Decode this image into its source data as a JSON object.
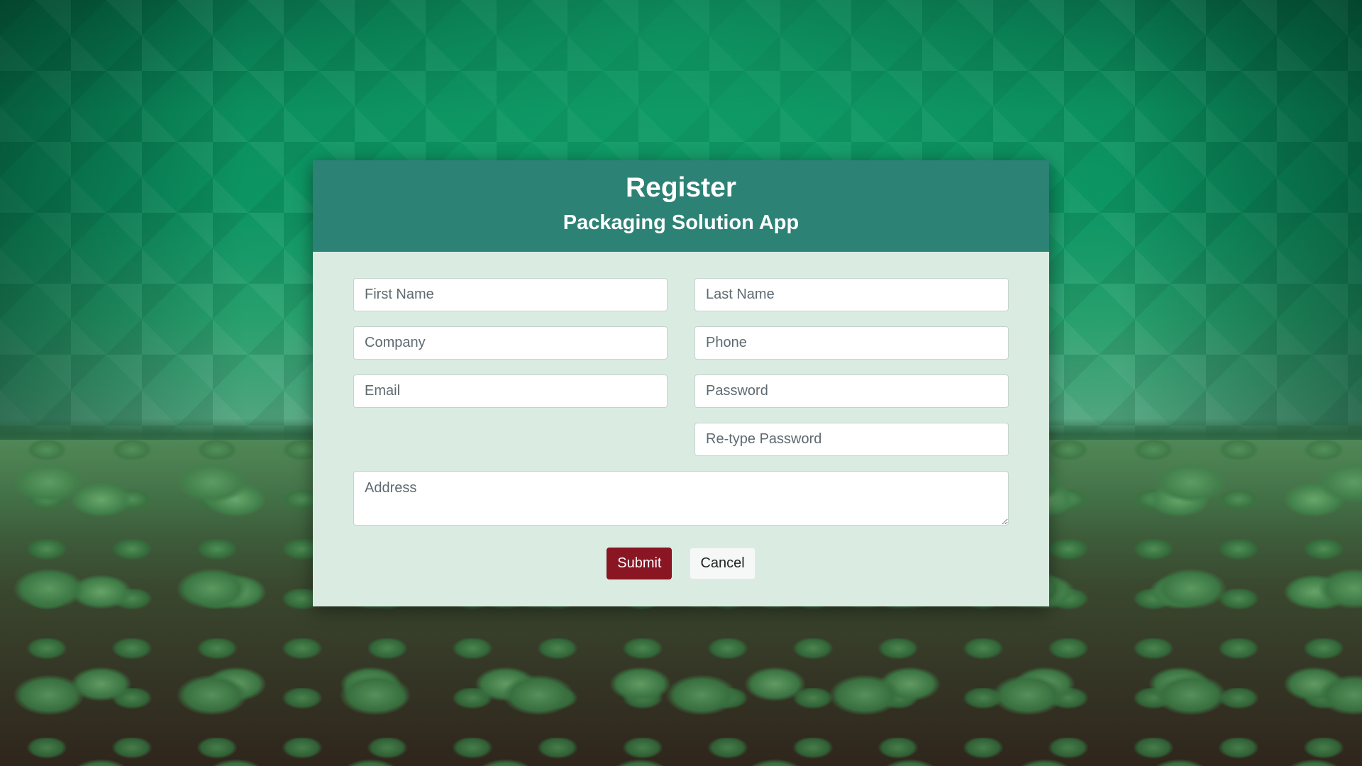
{
  "header": {
    "title": "Register",
    "subtitle": "Packaging Solution App"
  },
  "form": {
    "first_name": {
      "placeholder": "First Name",
      "value": ""
    },
    "last_name": {
      "placeholder": "Last Name",
      "value": ""
    },
    "company": {
      "placeholder": "Company",
      "value": ""
    },
    "phone": {
      "placeholder": "Phone",
      "value": ""
    },
    "email": {
      "placeholder": "Email",
      "value": ""
    },
    "password": {
      "placeholder": "Password",
      "value": ""
    },
    "retype_password": {
      "placeholder": "Re-type Password",
      "value": ""
    },
    "address": {
      "placeholder": "Address",
      "value": ""
    }
  },
  "actions": {
    "submit_label": "Submit",
    "cancel_label": "Cancel"
  },
  "colors": {
    "header_bg": "#2c8275",
    "body_bg": "#daece2",
    "submit_bg": "#8a1624",
    "cancel_bg": "#f6f8f7"
  }
}
